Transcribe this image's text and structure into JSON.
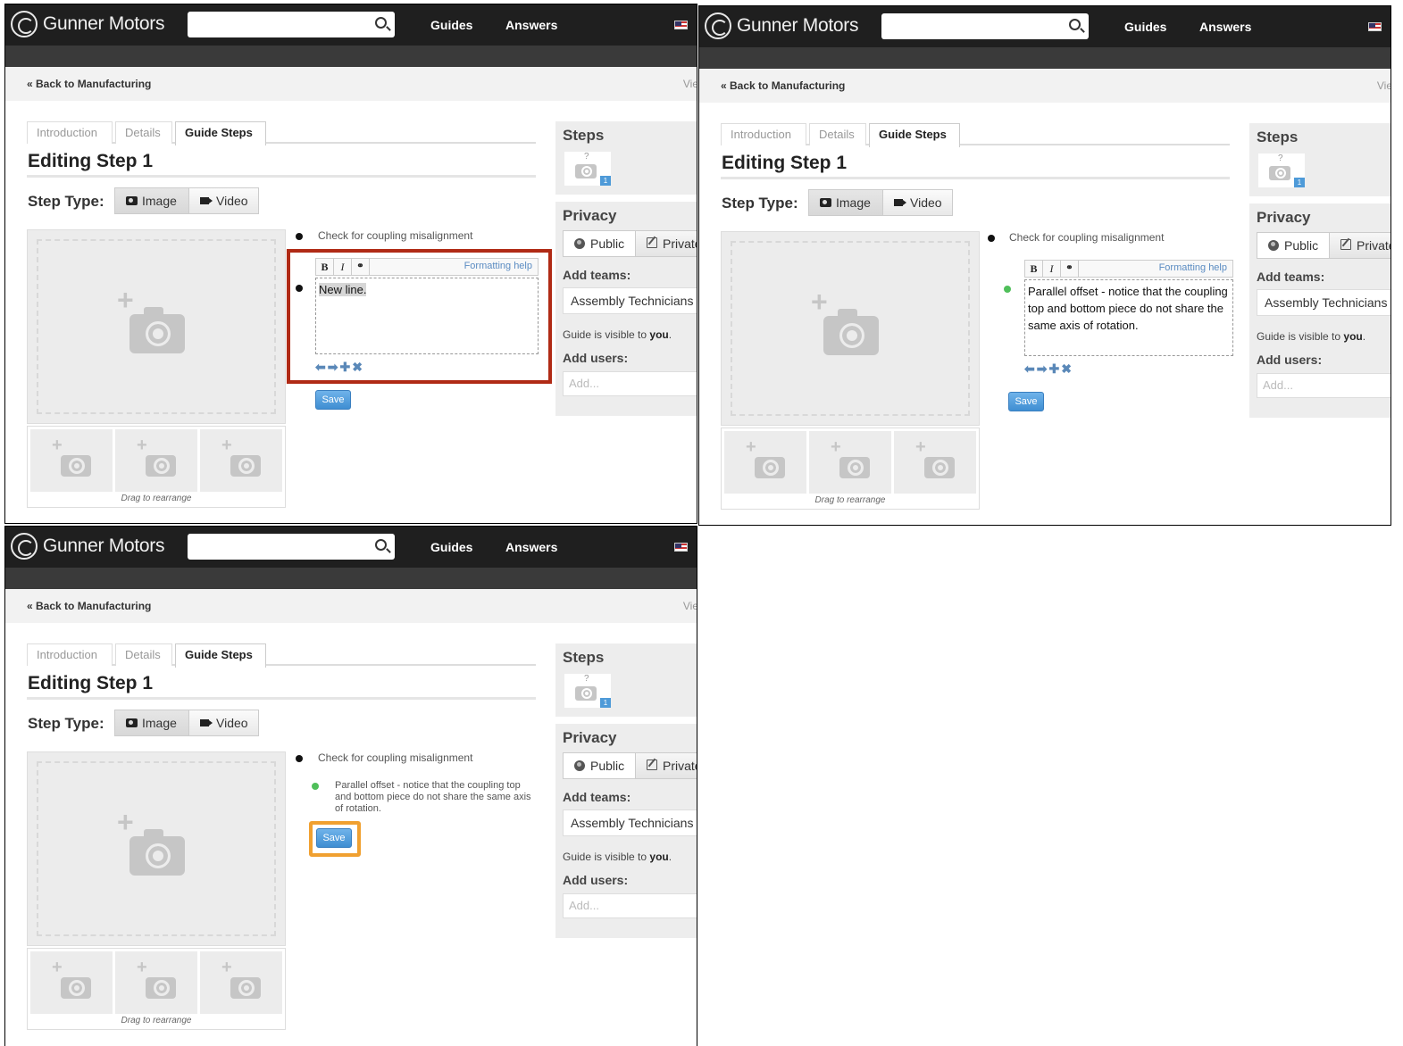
{
  "header": {
    "brand": "Gunner Motors",
    "nav": [
      "Guides",
      "Answers"
    ]
  },
  "breadcrumb": "« Back to Manufacturing",
  "view_fragment": "Vie",
  "tabs": [
    "Introduction",
    "Details",
    "Guide Steps"
  ],
  "page_title": "Editing Step 1",
  "step_type": {
    "label": "Step Type:",
    "image": "Image",
    "video": "Video"
  },
  "drag_hint": "Drag to rearrange",
  "bullet_first": "Check for coupling misalignment",
  "editor": {
    "bold": "B",
    "italic": "I",
    "link": "⚭",
    "help": "Formatting help"
  },
  "panel1": {
    "editor_text": "New line."
  },
  "panel2": {
    "editor_text": "Parallel offset - notice that the coupling top and bottom piece do not share the same axis of rotation."
  },
  "panel3": {
    "saved_text": "Parallel offset - notice that the coupling top and bottom piece do not share the same axis of rotation."
  },
  "arrows": [
    "⬅",
    "➡",
    "✚",
    "✖"
  ],
  "save": "Save",
  "sidebar": {
    "steps_title": "Steps",
    "step_thumb_q": "?",
    "step_thumb_num": "1",
    "privacy_title": "Privacy",
    "public": "Public",
    "private": "Private",
    "add_teams": "Add teams:",
    "team": "Assembly Technicians",
    "visible_prefix": "Guide is visible to",
    "visible_you": "you",
    "visible_suffix": ".",
    "add_users": "Add users:",
    "users_placeholder": "Add..."
  },
  "colors": {
    "highlight_red": "#b02a15",
    "highlight_orange": "#f0a030",
    "save_blue": "#3f8ed2",
    "bullet_green": "#4fbf5a"
  }
}
